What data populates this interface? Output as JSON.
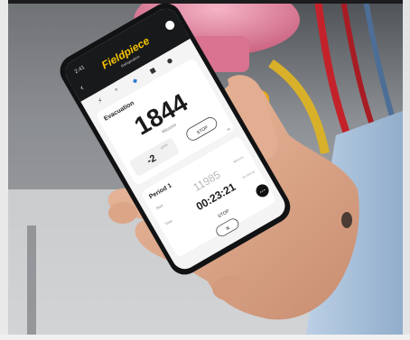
{
  "phone": {
    "status_time": "2:41",
    "app_brand": "Fieldpiece",
    "app_subtitle": "Refrigeration",
    "evacuation": {
      "title": "Evacuation",
      "value": "1844",
      "unit": "Microns",
      "rate": "-2",
      "rate_unit": "µ/min",
      "stop_label": "STOP"
    },
    "period": {
      "title": "Period 1",
      "start_label": "Start",
      "start_value": "11985",
      "start_unit": "Microns",
      "time_label": "Time",
      "time_value": "00:23:21",
      "time_unit": "hh:mm:ss",
      "stop_label": "STOP",
      "more_glyph": "•••",
      "close_glyph": "✕"
    }
  },
  "colors": {
    "brand_yellow": "#f5c400",
    "phone_body": "#111214",
    "screen_bg": "#f4f4f5",
    "card_bg": "#ffffff",
    "skin": "#e2ad90",
    "sleeve": "#a9bfd8",
    "pink_tank": "#e88aa6",
    "yellow_tool": "#e7a816",
    "red_hose": "#c4222b"
  }
}
